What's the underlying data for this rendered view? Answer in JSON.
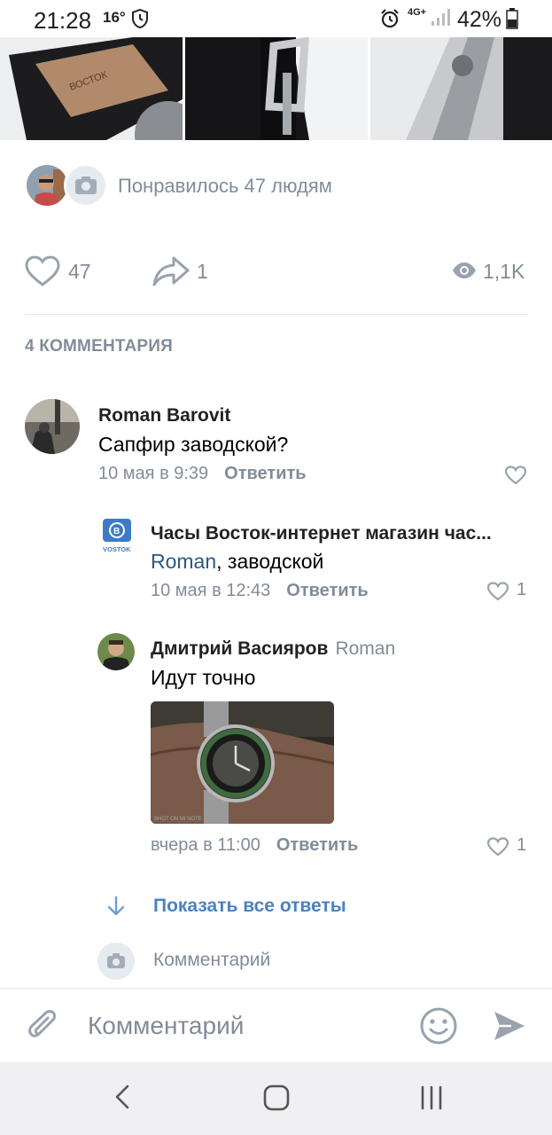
{
  "status_bar": {
    "time": "21:28",
    "temperature": "16°",
    "network": "4G+",
    "battery": "42%"
  },
  "post": {
    "likes_summary": "Понравилось 47 людям",
    "like_count": "47",
    "share_count": "1",
    "view_count": "1,1K"
  },
  "comments_header": "4 КОММЕНТАРИЯ",
  "comments": [
    {
      "author": "Roman Barovit",
      "text": "Сапфир заводской?",
      "date": "10 мая в 9:39",
      "reply_label": "Ответить",
      "likes": ""
    },
    {
      "author": "Часы Восток-интернет магазин час...",
      "mention": "Roman",
      "text": ", заводской",
      "date": "10 мая в 12:43",
      "reply_label": "Ответить",
      "likes": "1"
    },
    {
      "author": "Дмитрий Васияров",
      "reply_to": "Roman",
      "text": "Идут точно",
      "date": "вчера в 11:00",
      "reply_label": "Ответить",
      "likes": "1"
    }
  ],
  "show_all_replies": "Показать все ответы",
  "inline_comment_placeholder": "Комментарий",
  "composer": {
    "placeholder": "Комментарий"
  },
  "colors": {
    "secondary_text": "#818c99",
    "link": "#2a5885",
    "accent": "#4a82c1"
  }
}
